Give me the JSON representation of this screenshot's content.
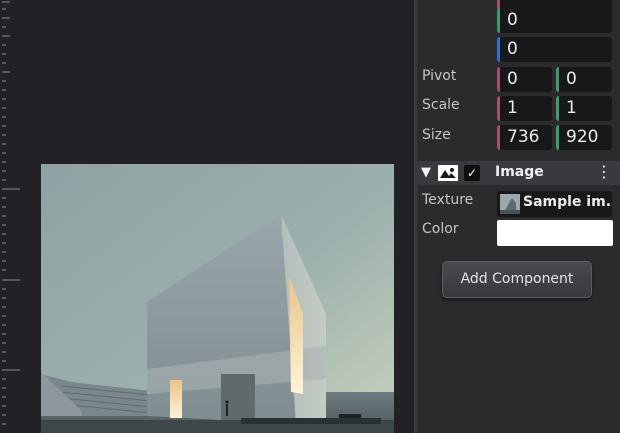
{
  "inspector": {
    "position": {
      "y_value": "0",
      "z_value": "0"
    },
    "pivot": {
      "label": "Pivot",
      "x": "0",
      "y": "0"
    },
    "scale": {
      "label": "Scale",
      "x": "1",
      "y": "1"
    },
    "size": {
      "label": "Size",
      "width": "736",
      "height": "920"
    },
    "image_component": {
      "title": "Image",
      "enabled": true,
      "texture_label": "Texture",
      "texture_value": "Sample im...",
      "color_label": "Color",
      "color_value": "#ffffff"
    },
    "add_component_label": "Add Component"
  },
  "colors": {
    "axis_x": "#a54f69",
    "axis_y": "#3f9a6e",
    "axis_z": "#2f6fd0"
  }
}
